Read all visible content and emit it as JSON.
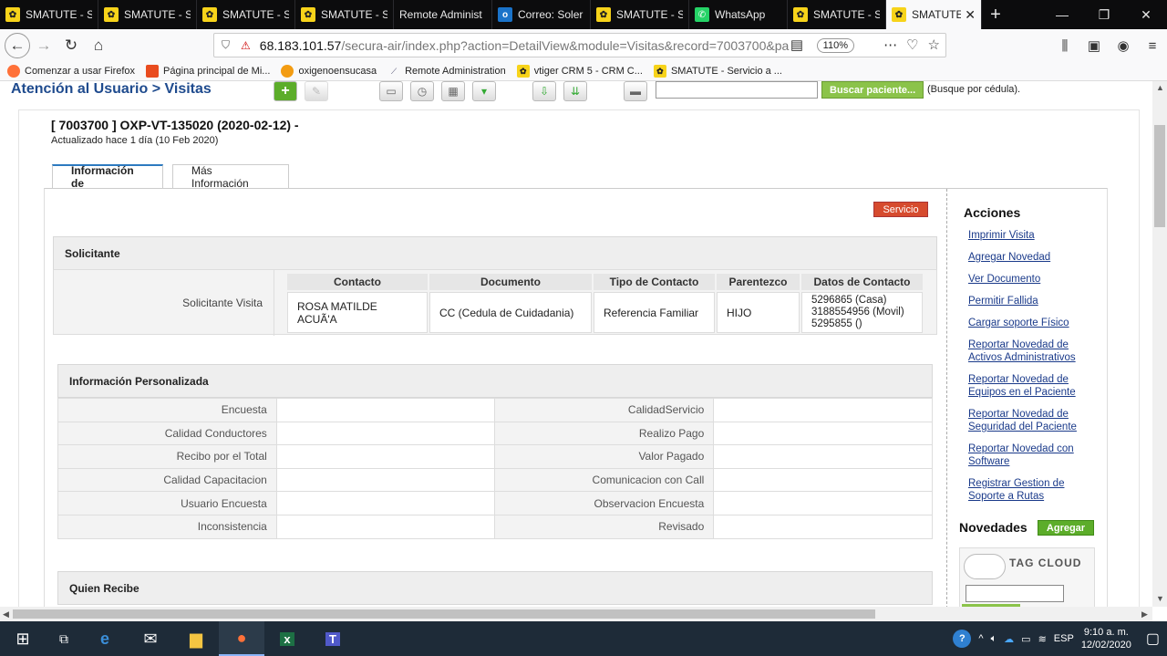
{
  "browser": {
    "tabs": [
      {
        "title": "SMATUTE - Se",
        "icon": "smatute-icon"
      },
      {
        "title": "SMATUTE - Se",
        "icon": "smatute-icon"
      },
      {
        "title": "SMATUTE - Se",
        "icon": "smatute-icon"
      },
      {
        "title": "SMATUTE - Se",
        "icon": "smatute-icon"
      },
      {
        "title": "Remote Administ",
        "icon": "none"
      },
      {
        "title": "Correo: Soler",
        "icon": "outlook-icon"
      },
      {
        "title": "SMATUTE - Se",
        "icon": "smatute-icon"
      },
      {
        "title": "WhatsApp",
        "icon": "whatsapp-icon"
      },
      {
        "title": "SMATUTE - Se",
        "icon": "smatute-icon"
      },
      {
        "title": "SMATUTE",
        "icon": "smatute-icon"
      }
    ],
    "url_host": "68.183.101.57",
    "url_path": "/secura-air/index.php?action=DetailView&module=Visitas&record=7003700&pa",
    "zoom": "110%",
    "bookmarks": [
      "Comenzar a usar Firefox",
      "Página principal de Mi...",
      "oxigenoensucasa",
      "Remote Administration",
      "vtiger CRM 5 - CRM C...",
      "SMATUTE - Servicio a ..."
    ]
  },
  "page": {
    "header": "Atención al Usuario > Visitas",
    "search_button": "Buscar paciente...",
    "search_hint": "(Busque por cédula).",
    "record_title": "[ 7003700 ] OXP-VT-135020 (2020-02-12) -",
    "record_updated": "Actualizado hace 1 día (10 Feb 2020)",
    "tabs": [
      "Información de",
      "Más Información"
    ],
    "service_badge": "Servicio",
    "solicitante": {
      "section": "Solicitante",
      "label": "Solicitante Visita",
      "headers": [
        "Contacto",
        "Documento",
        "Tipo de Contacto",
        "Parentezco",
        "Datos de Contacto"
      ],
      "row": [
        "ROSA MATILDE ACUÃ'A",
        "CC (Cedula de Cuidadania)",
        "Referencia Familiar",
        "HIJO",
        "5296865 (Casa)",
        "3188554956 (Movil)",
        "5295855 ()"
      ]
    },
    "personalizada": {
      "section": "Información Personalizada",
      "rows": [
        [
          "Encuesta",
          "CalidadServicio"
        ],
        [
          "Calidad Conductores",
          "Realizo Pago"
        ],
        [
          "Recibo por el Total",
          "Valor Pagado"
        ],
        [
          "Calidad Capacitacion",
          "Comunicacion con Call"
        ],
        [
          "Usuario Encuesta",
          "Observacion Encuesta"
        ],
        [
          "Inconsistencia",
          "Revisado"
        ]
      ]
    },
    "quien_recibe": "Quien Recibe",
    "acciones": {
      "title": "Acciones",
      "links": [
        "Imprimir Visita",
        "Agregar Novedad",
        "Ver Documento",
        "Permitir Fallida",
        "Cargar soporte Físico",
        "Reportar Novedad de Activos Administrativos",
        "Reportar Novedad de Equipos en el Paciente",
        "Reportar Novedad de Seguridad del Paciente",
        "Reportar Novedad con Software",
        "Registrar Gestion de Soporte a Rutas"
      ]
    },
    "novedades": "Novedades",
    "agregar": "Agregar",
    "tag_cloud": "TAG CLOUD"
  },
  "taskbar": {
    "lang": "ESP",
    "time": "9:10 a. m.",
    "date": "12/02/2020"
  }
}
